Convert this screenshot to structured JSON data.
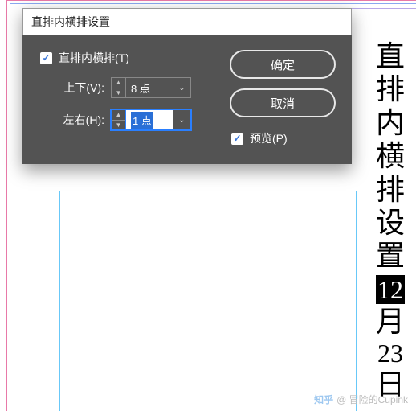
{
  "dialog": {
    "title": "直排内横排设置",
    "checkbox_label": "直排内横排(T)",
    "checkbox_checked": true,
    "vertical_label": "上下(V):",
    "vertical_value": "8 点",
    "horizontal_label": "左右(H):",
    "horizontal_value": "1 点",
    "ok_label": "确定",
    "cancel_label": "取消",
    "preview_label": "预览(P)",
    "preview_checked": true
  },
  "document": {
    "chars": [
      "直",
      "排",
      "内",
      "横",
      "排",
      "设",
      "置"
    ],
    "highlight": "12",
    "tail": [
      "月",
      "23",
      "日"
    ]
  },
  "watermark": {
    "site": "知乎",
    "user": "@ 冒险的Cupink"
  }
}
